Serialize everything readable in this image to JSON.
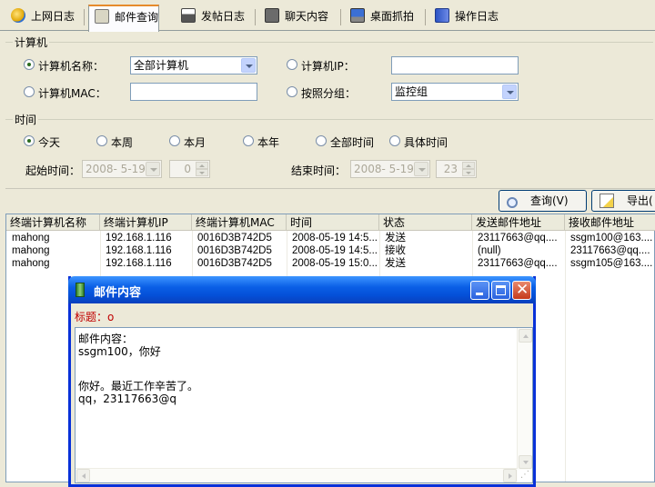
{
  "tabs": [
    {
      "label": "上网日志",
      "icon": "globe-icon"
    },
    {
      "label": "邮件查询",
      "icon": "mail-icon",
      "active": true
    },
    {
      "label": "发帖日志",
      "icon": "printer-icon"
    },
    {
      "label": "聊天内容",
      "icon": "chat-icon"
    },
    {
      "label": "桌面抓拍",
      "icon": "desktop-icon"
    },
    {
      "label": "操作日志",
      "icon": "log-icon"
    }
  ],
  "computer_group": {
    "title": "计算机",
    "name_label": "计算机名称：",
    "name_value": "全部计算机",
    "ip_label": "计算机IP：",
    "ip_value": "",
    "mac_label": "计算机MAC：",
    "mac_value": "",
    "group_label": "按照分组：",
    "group_value": "监控组",
    "selected": "name"
  },
  "time_group": {
    "title": "时间",
    "options": [
      "今天",
      "本周",
      "本月",
      "本年",
      "全部时间",
      "具体时间"
    ],
    "selected": "今天",
    "start_label": "起始时间：",
    "start_date": "2008- 5-19",
    "start_hour": "0",
    "end_label": "结束时间：",
    "end_date": "2008- 5-19",
    "end_hour": "23"
  },
  "toolbar": {
    "query_label": "查询(V)",
    "export_label": "导出("
  },
  "table": {
    "columns": [
      "终端计算机名称",
      "终端计算机IP",
      "终端计算机MAC",
      "时间",
      "状态",
      "发送邮件地址",
      "接收邮件地址"
    ],
    "rows": [
      [
        "mahong",
        "192.168.1.116",
        "0016D3B742D5",
        "2008-05-19 14:5...",
        "发送",
        "23117663@qq....",
        "ssgm100@163...."
      ],
      [
        "mahong",
        "192.168.1.116",
        "0016D3B742D5",
        "2008-05-19 14:5...",
        "接收",
        "(null)",
        "23117663@qq...."
      ],
      [
        "mahong",
        "192.168.1.116",
        "0016D3B742D5",
        "2008-05-19 15:0...",
        "发送",
        "23117663@qq....",
        "ssgm105@163...."
      ]
    ]
  },
  "dialog": {
    "title": "邮件内容",
    "subject": "标题：o",
    "content_lines": [
      "邮件内容：",
      "ssgm100，你好",
      "",
      "",
      "你好。最近工作辛苦了。",
      "qq，23117663@q"
    ]
  },
  "colors": {
    "window_bg": "#ece9d8",
    "title_bar": "#0a5fe6",
    "subject_text": "#c00000",
    "tab_active_accent": "#e68b2c"
  }
}
